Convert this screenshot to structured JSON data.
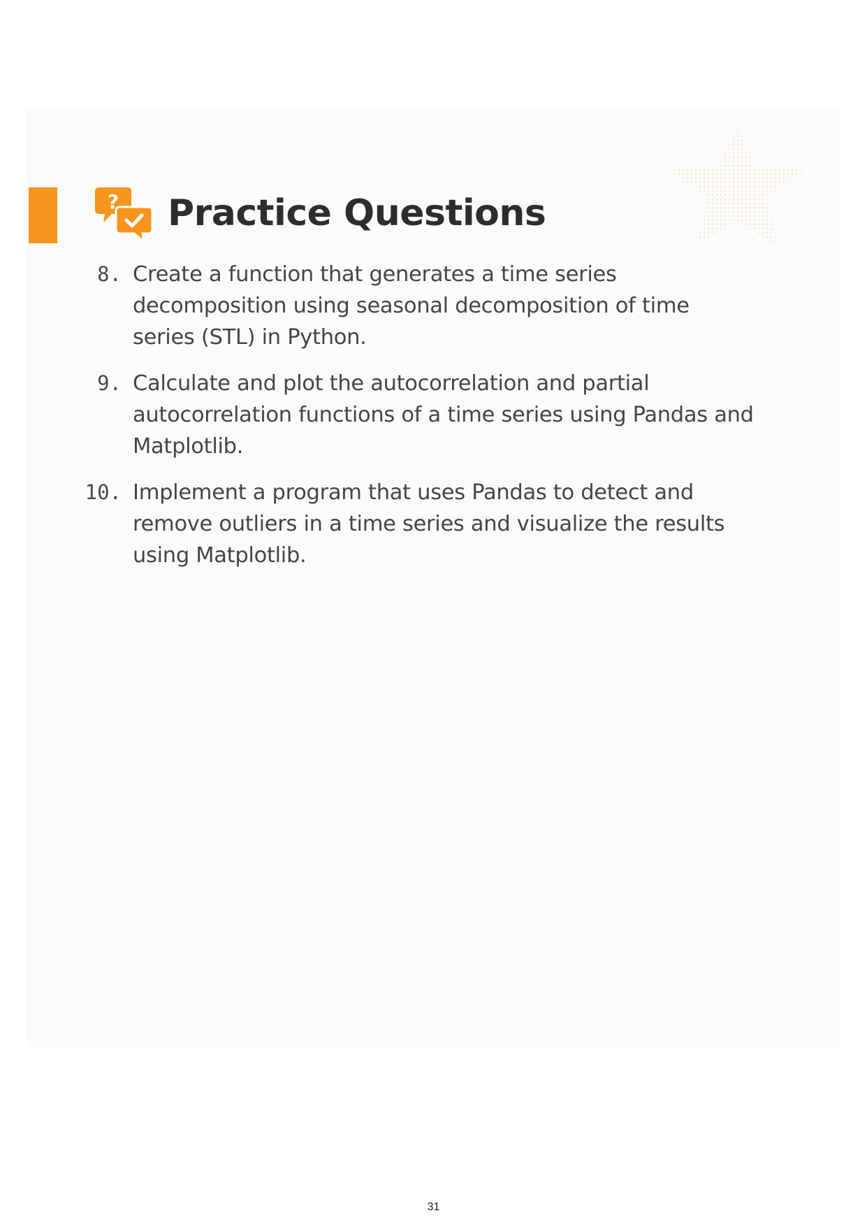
{
  "colors": {
    "accent": "#f7941d",
    "panel_background": "#fdfbf9",
    "title_text": "#2d2d2d",
    "body_text": "#454545"
  },
  "header": {
    "icon": "question-answer-chat-bubbles-icon",
    "title": "Practice Questions"
  },
  "watermark": {
    "icon": "dotted-star-watermark-icon"
  },
  "questions": [
    {
      "number": "8.",
      "text": "Create a function that generates a time series decomposition using seasonal decomposition of time series (STL) in Python."
    },
    {
      "number": "9.",
      "text": "Calculate and plot the autocorrelation and partial autocorrelation functions of a time series using Pandas and Matplotlib."
    },
    {
      "number": "10.",
      "text": "Implement a program that uses Pandas to detect and remove outliers in a time series and visualize the results using Matplotlib."
    }
  ],
  "footer": {
    "page_number": "31"
  }
}
